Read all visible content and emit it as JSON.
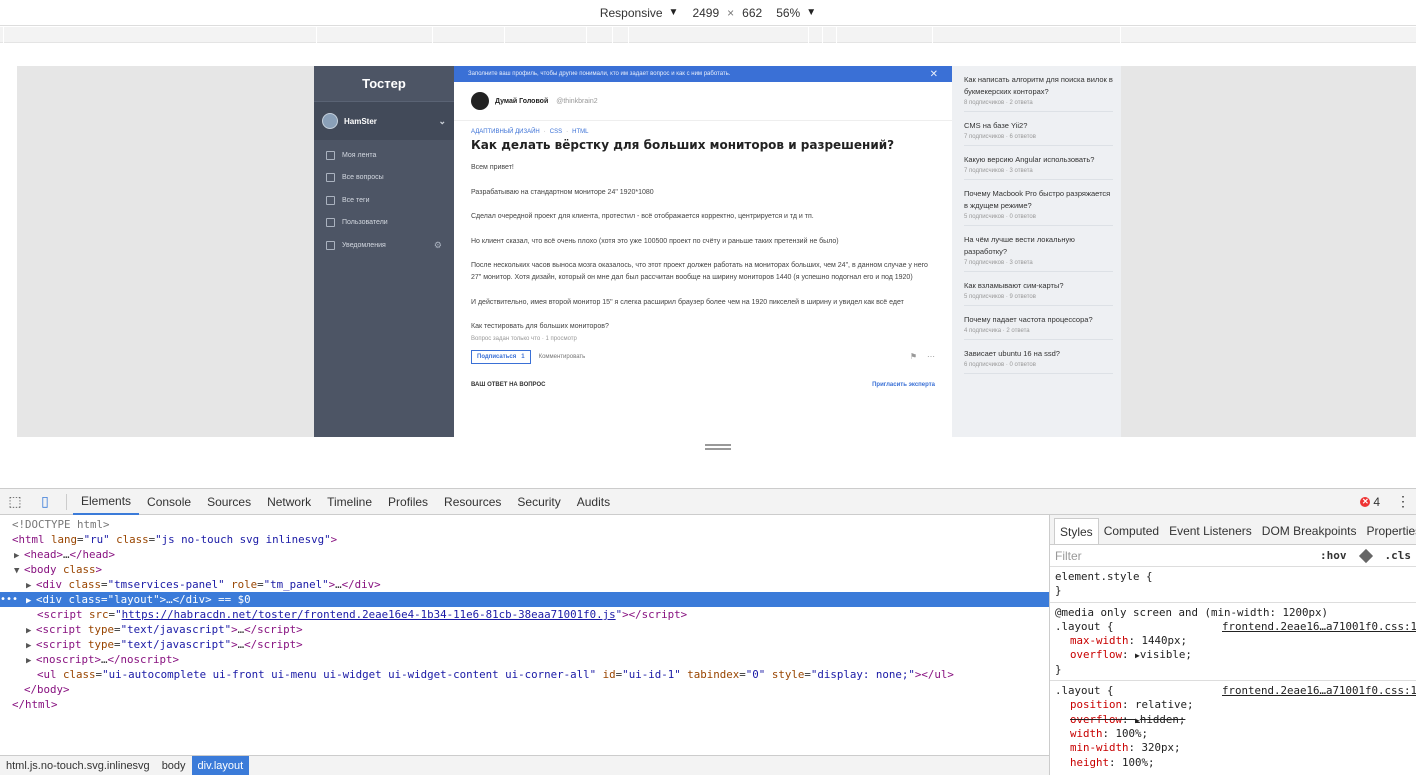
{
  "device_toolbar": {
    "mode": "Responsive",
    "width": "2499",
    "times": "×",
    "height": "662",
    "zoom": "56%"
  },
  "page": {
    "logo": "Тостер",
    "user": "HamSter",
    "menu": [
      "Моя лента",
      "Все вопросы",
      "Все теги",
      "Пользователи",
      "Уведомления"
    ],
    "banner": "Заполните ваш профиль, чтобы другие понимали, кто им задает вопрос и как с ним работать.",
    "author_name": "Думай Головой",
    "author_handle": "@thinkbrain2",
    "tags": [
      "АДАПТИВНЫЙ ДИЗАЙН",
      "CSS",
      "HTML"
    ],
    "tag_sep": "·",
    "question_title": "Как делать вёрстку для больших мониторов и разрешений?",
    "body": [
      "Всем привет!",
      "Разрабатываю на стандартном мониторе 24\" 1920*1080",
      "Сделал очередной проект для клиента, протестил - всё отображается корректно, центрируется и тд и тп.",
      "Но клиент сказал, что всё очень плохо (хотя это уже 100500 проект по счёту и раньше таких претензий не было)",
      "После нескольких часов выноса мозга оказалось, что этот проект должен работать на мониторах больших, чем 24\", в данном случае у него 27\" монитор. Хотя дизайн, который он мне дал был рассчитан вообще на ширину мониторов 1440 (я успешно подогнал его и под 1920)",
      "И действительно, имея второй монитор 15\" я слегка расширил браузер более чем на 1920 пикселей в ширину и увидел как всё едет",
      "Как тестировать для больших мониторов?"
    ],
    "meta": "Вопрос задан только что · 1 просмотр",
    "subscribe": "Подписаться",
    "subscribe_count": "1",
    "comment": "Комментировать",
    "answer_heading": "ВАШ ОТВЕТ НА ВОПРОС",
    "invite_expert": "Пригласить эксперта",
    "related": [
      {
        "title": "Как написать алгоритм для поиска вилок в букмекерских конторах?",
        "meta": "8 подписчиков · 2 ответа"
      },
      {
        "title": "CMS на базе Yii2?",
        "meta": "7 подписчиков · 6 ответов"
      },
      {
        "title": "Какую версию Angular использовать?",
        "meta": "7 подписчиков · 3 ответа"
      },
      {
        "title": "Почему Macbook Pro быстро разряжается в ждущем режиме?",
        "meta": "5 подписчиков · 0 ответов"
      },
      {
        "title": "На чём лучше вести локальную разработку?",
        "meta": "7 подписчиков · 3 ответа"
      },
      {
        "title": "Как взламывают сим-карты?",
        "meta": "5 подписчиков · 9 ответов"
      },
      {
        "title": "Почему падает частота процессора?",
        "meta": "4 подписчика · 2 ответа"
      },
      {
        "title": "Зависает ubuntu 16 на ssd?",
        "meta": "6 подписчиков · 0 ответов"
      }
    ]
  },
  "devtools": {
    "tabs": [
      "Elements",
      "Console",
      "Sources",
      "Network",
      "Timeline",
      "Profiles",
      "Resources",
      "Security",
      "Audits"
    ],
    "error_count": "4",
    "dom": {
      "doctype": "<!DOCTYPE html>",
      "script_src": "https://habracdn.net/toster/frontend.2eae16e4-1b34-11e6-81cb-38eaa71001f0.js",
      "eq0": " == $0",
      "ul_class": "ui-autocomplete ui-front ui-menu ui-widget ui-widget-content ui-corner-all",
      "ul_id": "ui-id-1",
      "ul_tabindex": "0",
      "ul_style": "display: none;"
    },
    "styles_tabs": [
      "Styles",
      "Computed",
      "Event Listeners",
      "DOM Breakpoints",
      "Properties"
    ],
    "filter_placeholder": "Filter",
    "hov": ":hov",
    "cls": ".cls",
    "rules": {
      "element_style": "element.style {",
      "media": "@media only screen and (min-width: 1200px)",
      "layout_sel": ".layout {",
      "source1": "frontend.2eae16…a71001f0.css:1",
      "source2": "frontend.2eae16…a71001f0.css:1",
      "close": "}"
    },
    "breadcrumb": [
      "html.js.no-touch.svg.inlinesvg",
      "body",
      "div.layout"
    ]
  }
}
